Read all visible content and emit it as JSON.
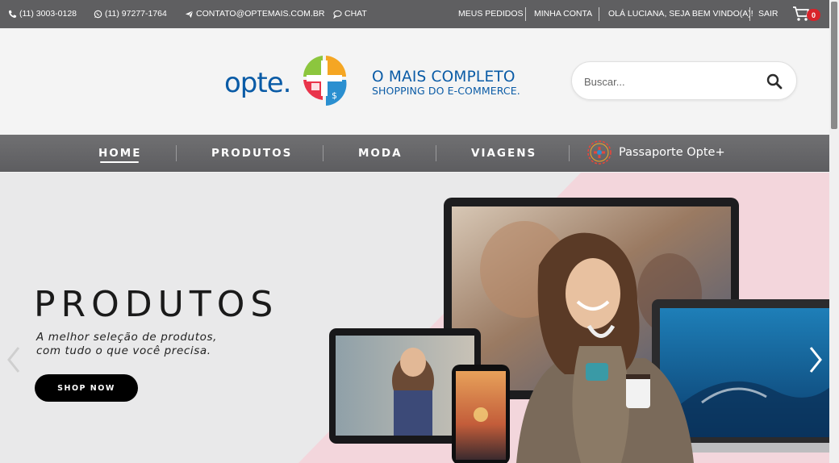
{
  "topbar": {
    "phone": "(11) 3003-0128",
    "whatsapp": "(11) 97277-1764",
    "email": "CONTATO@OPTEMAIS.COM.BR",
    "chat": "CHAT",
    "orders": "MEUS PEDIDOS",
    "account": "MINHA CONTA",
    "greeting": "OLÁ LUCIANA, SEJA BEM VINDO(A)!",
    "logout": "SAIR",
    "cart_count": "0"
  },
  "header": {
    "logo_text": "opte.",
    "slogan_line1": "O MAIS COMPLETO",
    "slogan_line2": "SHOPPING DO E-COMMERCE.",
    "search_placeholder": "Buscar..."
  },
  "nav": {
    "items": [
      {
        "label": "HOME",
        "active": true
      },
      {
        "label": "PRODUTOS"
      },
      {
        "label": "MODA"
      },
      {
        "label": "VIAGENS"
      }
    ],
    "passport": "Passaporte Opte+"
  },
  "hero": {
    "title": "PRODUTOS",
    "subtitle_line1": "A melhor seleção de produtos,",
    "subtitle_line2": "com tudo o que você precisa.",
    "cta": "SHOP NOW"
  },
  "colors": {
    "topbar": "#5f5f61",
    "brand_blue": "#0a5ba6",
    "cart_badge": "#d8232a",
    "hero_pink": "#f3d6dc"
  }
}
